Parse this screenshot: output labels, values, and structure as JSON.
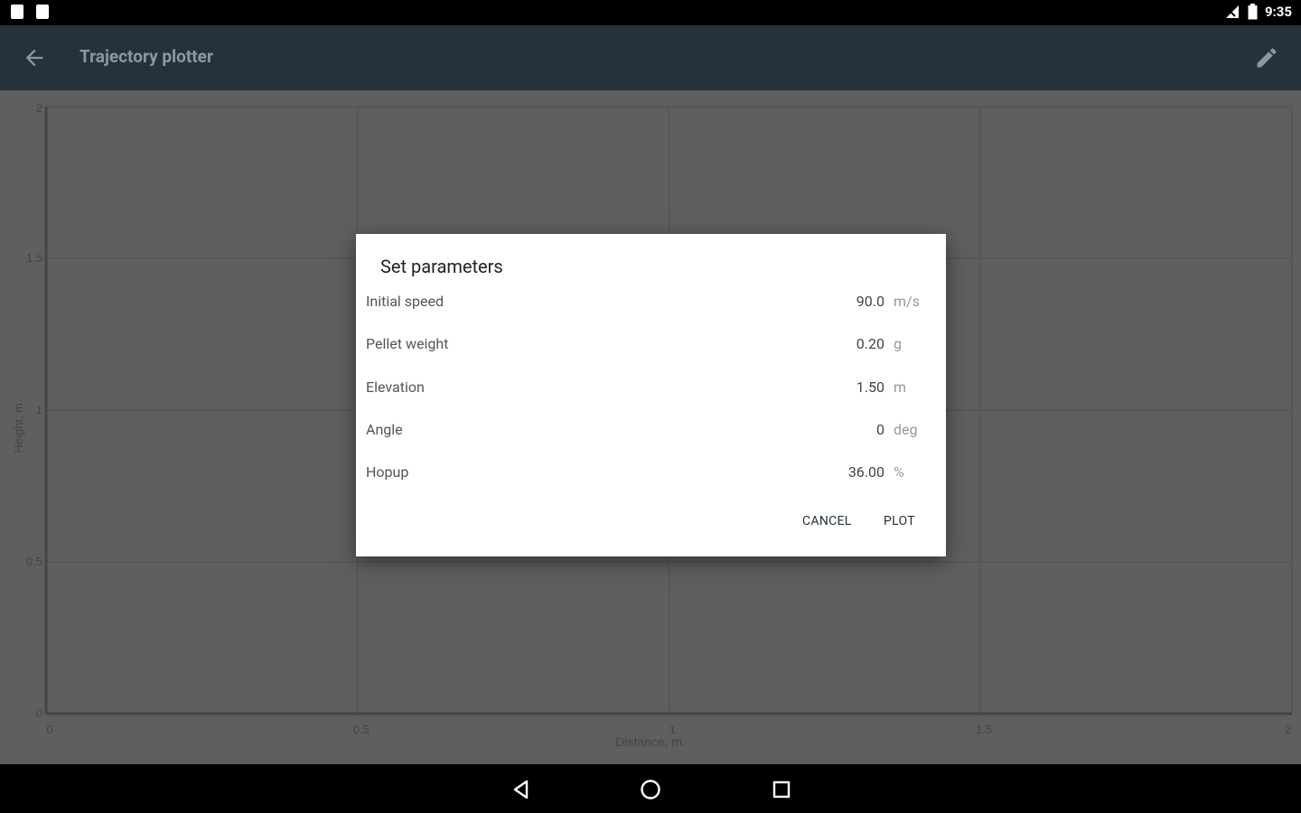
{
  "status_bar": {
    "time": "9:35",
    "icons": [
      "notification-icon",
      "notification-icon",
      "signal-icon",
      "battery-icon"
    ]
  },
  "app_bar": {
    "title": "Trajectory plotter",
    "icons": [
      "back-arrow-icon",
      "edit-pencil-icon"
    ]
  },
  "chart_data": {
    "type": "line",
    "xlabel": "Distance, m.",
    "ylabel": "Height, m.",
    "xlim": [
      0,
      2
    ],
    "ylim": [
      0,
      2
    ],
    "x_ticks": [
      "0",
      "0.5",
      "1",
      "1.5",
      "2"
    ],
    "y_ticks": [
      "0",
      "0.5",
      "1",
      "1.5",
      "2"
    ],
    "grid": true,
    "series": []
  },
  "dialog": {
    "title": "Set parameters",
    "params": [
      {
        "label": "Initial speed",
        "value": "90.0",
        "unit": "m/s"
      },
      {
        "label": "Pellet weight",
        "value": "0.20",
        "unit": "g"
      },
      {
        "label": "Elevation",
        "value": "1.50",
        "unit": "m"
      },
      {
        "label": "Angle",
        "value": "0",
        "unit": "deg"
      },
      {
        "label": "Hopup",
        "value": "36.00",
        "unit": "%"
      }
    ],
    "cancel_label": "CANCEL",
    "plot_label": "PLOT"
  },
  "nav_bar": {
    "icons": [
      "back-triangle-icon",
      "home-circle-icon",
      "recents-square-icon"
    ]
  },
  "colors": {
    "app_bar": "#26323a",
    "status_bar": "#000000",
    "scrim_background": "#5f5f5f",
    "dialog": "#ffffff",
    "accent": "#26323a"
  }
}
